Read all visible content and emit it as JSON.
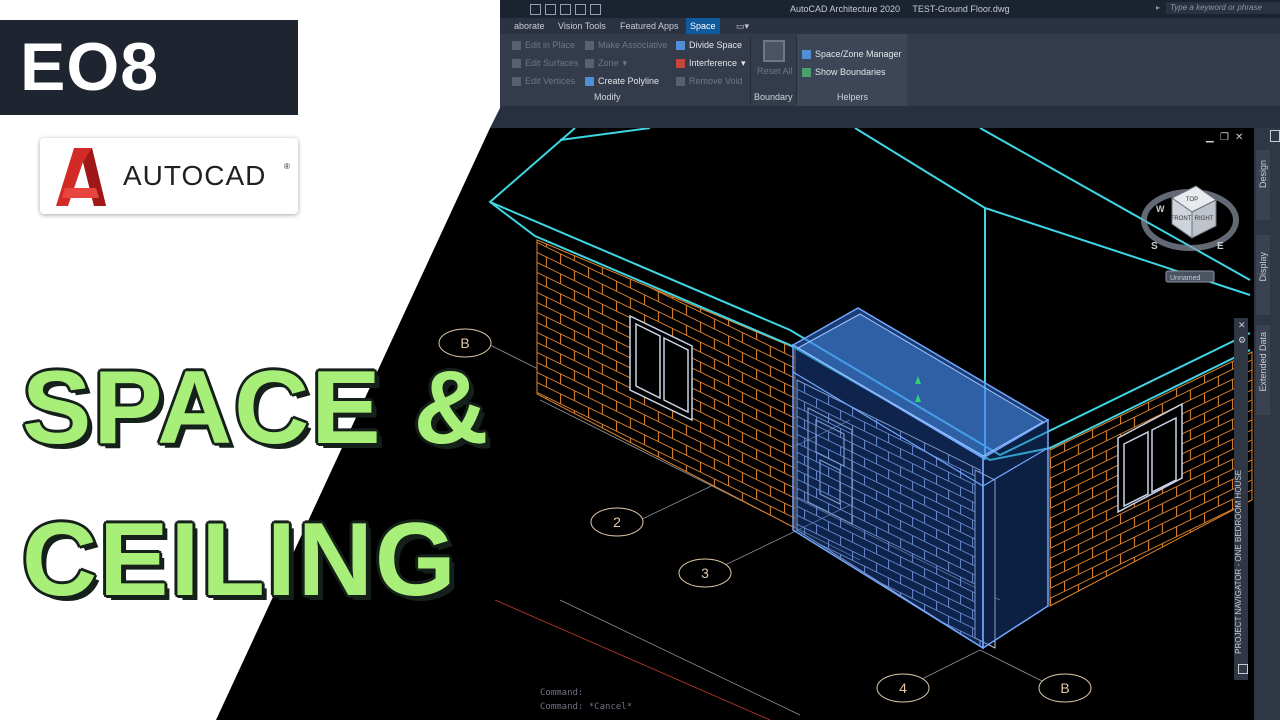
{
  "overlay": {
    "episode": "EO8",
    "brand": "AUTOCAD",
    "brand_mark": "®",
    "headline_line1": "SPACE &",
    "headline_line2": "CEILING"
  },
  "window": {
    "app_name": "AutoCAD Architecture 2020",
    "file_name": "TEST-Ground Floor.dwg",
    "search_placeholder": "Type a keyword or phrase"
  },
  "ribbon": {
    "tabs": [
      {
        "label": "aborate",
        "active": false
      },
      {
        "label": "Vision Tools",
        "active": false
      },
      {
        "label": "Featured Apps",
        "active": false
      },
      {
        "label": "Space",
        "active": true
      }
    ],
    "modify": {
      "col1": [
        "Edit in Place",
        "Edit Surfaces",
        "Edit Vertices"
      ],
      "col2": [
        "Make Associative",
        "Zone",
        "Create Polyline"
      ],
      "col3": [
        "Divide Space",
        "Interference",
        "Remove Void"
      ],
      "label": "Modify"
    },
    "boundary": {
      "reset_all": "Reset All",
      "label": "Boundary"
    },
    "helpers": {
      "items": [
        "Space/Zone Manager",
        "Show Boundaries"
      ],
      "label": "Helpers"
    }
  },
  "viewcube": {
    "faces": {
      "top": "TOP",
      "front": "FRONT",
      "right": "RIGHT"
    },
    "compass": {
      "w": "W",
      "s": "S",
      "e": "E"
    },
    "view_name": "Unnamed"
  },
  "grid_bubbles": [
    "B",
    "2",
    "3",
    "4",
    "B"
  ],
  "palettes": {
    "design": "Design",
    "display": "Display",
    "extended_data": "Extended Data",
    "project_navigator": "PROJECT NAVIGATOR - ONE BEDROOM HOUSE"
  },
  "command_history": [
    "Command:",
    "Command: *Cancel*"
  ],
  "colors": {
    "headline": "#a8ef7a",
    "outline": "#16201a",
    "badge_bg": "#1f2530",
    "roof_edge": "#3fd6e4",
    "brick": "#e0852e",
    "space_fill": "#2f6fd6",
    "active_tab": "#0f5b9e",
    "logo_red": "#d22a27"
  }
}
